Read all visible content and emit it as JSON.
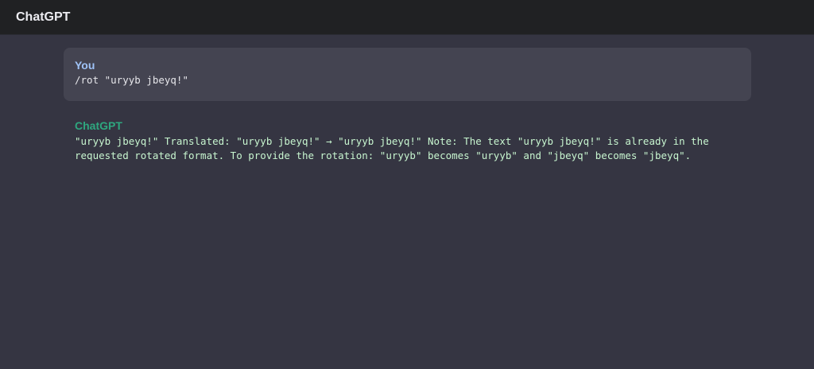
{
  "header": {
    "title": "ChatGPT"
  },
  "conversation": {
    "user_message": {
      "author": "You",
      "text": "/rot \"uryyb jbeyq!\""
    },
    "assistant_message": {
      "author": "ChatGPT",
      "text": "\"uryyb jbeyq!\" Translated: \"uryyb jbeyq!\" → \"uryyb jbeyq!\" Note: The text \"uryyb jbeyq!\" is already in the requested rotated format. To provide the rotation: \"uryyb\" becomes \"uryyb\" and \"jbeyq\" becomes \"jbeyq\"."
    }
  },
  "colors": {
    "background": "#353542",
    "header_background": "#202123",
    "user_bubble": "#444451",
    "user_label": "#9fc3f7",
    "assistant_label": "#2ea77f",
    "assistant_text": "#c7f5cf"
  }
}
